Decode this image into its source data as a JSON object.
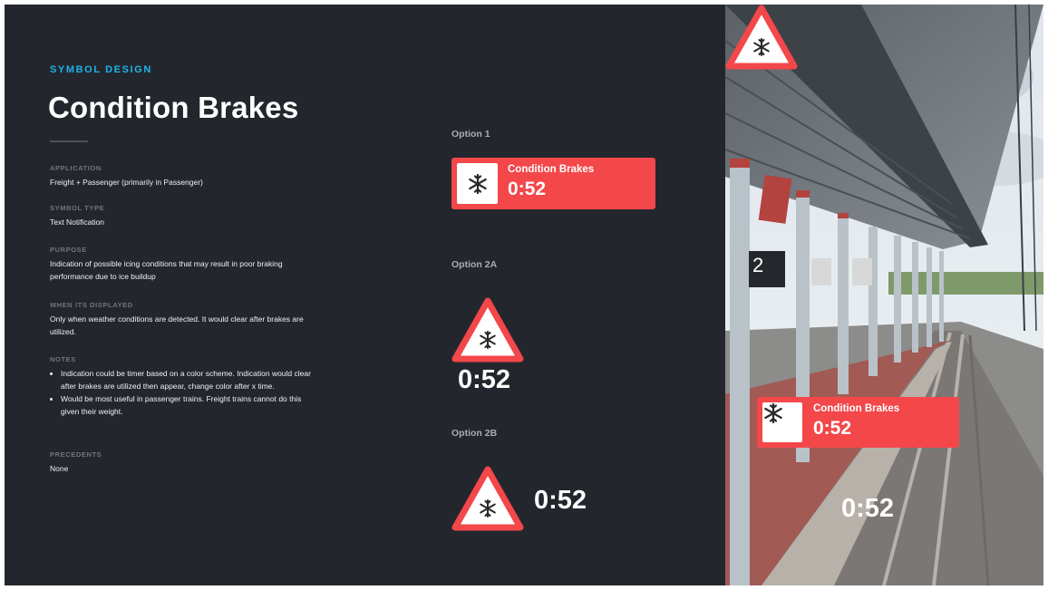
{
  "header": {
    "eyebrow": "SYMBOL DESIGN",
    "title": "Condition Brakes"
  },
  "details": [
    {
      "label": "APPLICATION",
      "value": "Freight + Passenger (primarily in Passenger)"
    },
    {
      "label": "SYMBOL TYPE",
      "value": "Text Notification"
    },
    {
      "label": "PURPOSE",
      "value": "Indication of possible icing conditions that may result in poor braking performance due to ice buildup"
    },
    {
      "label": "WHEN ITS DISPLAYED",
      "value": "Only when weather conditions are detected. It would clear after brakes are utilized."
    },
    {
      "label": "NOTES",
      "bullets": [
        "Indication could be timer based on a color scheme. Indication would clear after brakes are utilized then appear, change color after x time.",
        "Would be most useful in passenger trains. Freight trains cannot do this given their weight."
      ]
    },
    {
      "label": "PRECEDENTS",
      "value": "None"
    }
  ],
  "options": {
    "option1": {
      "label": "Option 1",
      "banner_title": "Condition Brakes",
      "time": "0:52"
    },
    "option2a": {
      "label": "Option 2A",
      "time": "0:52"
    },
    "option2b": {
      "label": "Option 2B",
      "time": "0:52"
    }
  },
  "photo": {
    "platform_number": "2",
    "banner_title": "Condition Brakes",
    "banner_time": "0:52",
    "triangle_time": "0:52"
  },
  "icons": [
    "snowflake-icon",
    "warning-triangle-icon"
  ],
  "colors": {
    "background": "#23272d",
    "accent": "#20b3e6",
    "alert_red": "#f3474a",
    "text": "#ffffff"
  }
}
